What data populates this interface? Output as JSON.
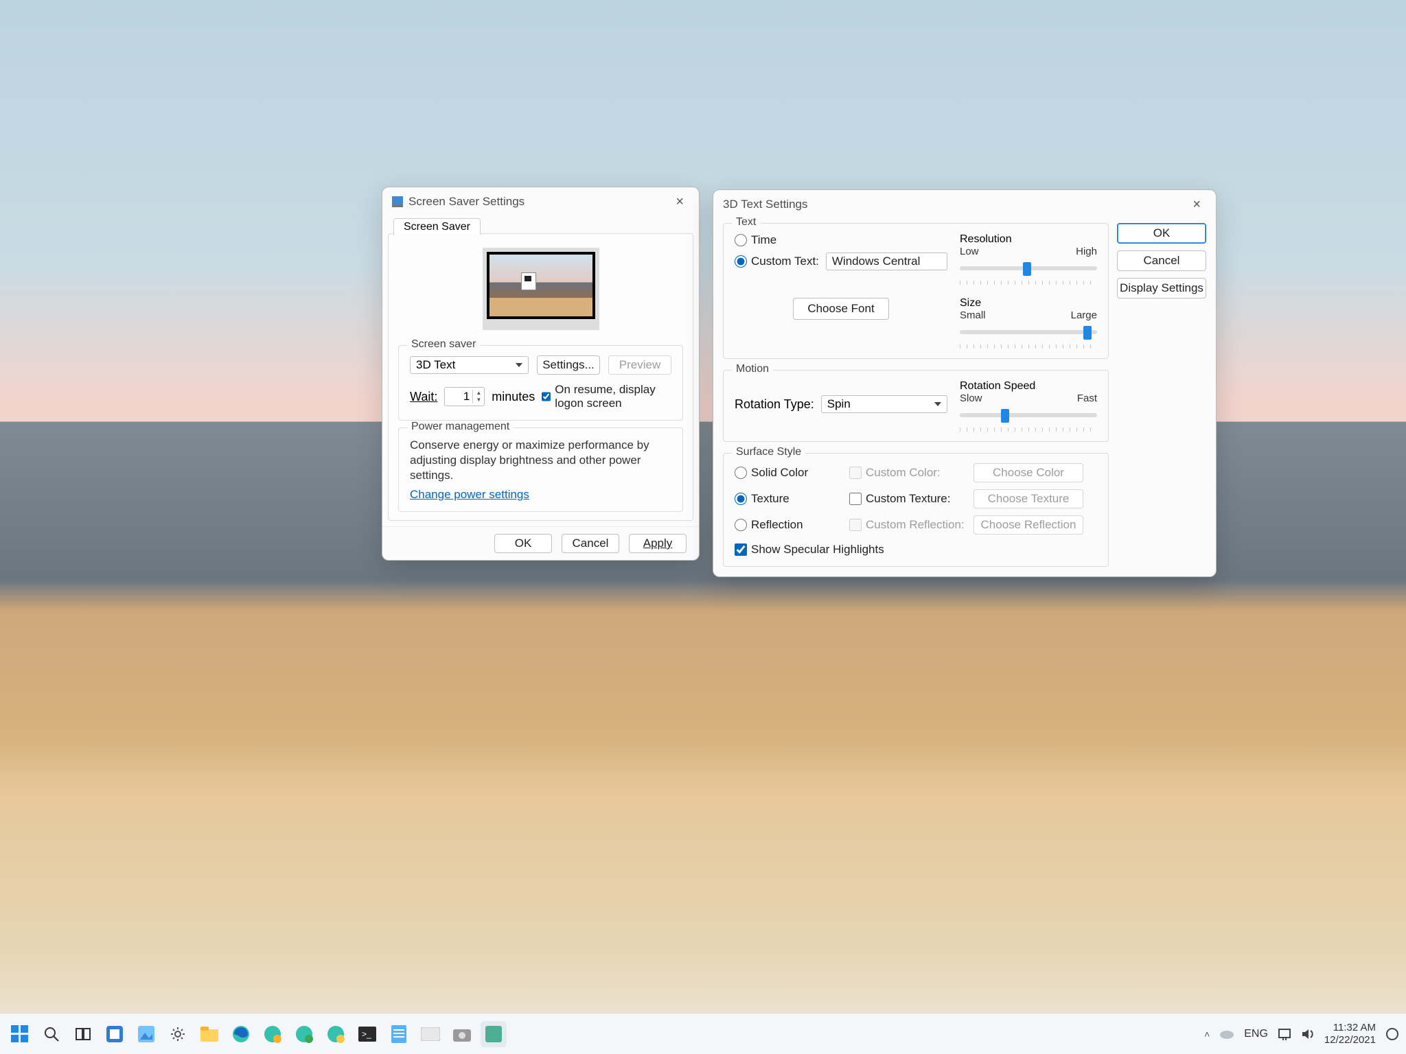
{
  "screensaver": {
    "title": "Screen Saver Settings",
    "tab": "Screen Saver",
    "section_label": "Screen saver",
    "selected": "3D Text",
    "settings_btn": "Settings...",
    "preview_btn": "Preview",
    "wait_label": "Wait:",
    "wait_value": "1",
    "wait_unit": "minutes",
    "resume_label": "On resume, display logon screen",
    "pm_label": "Power management",
    "pm_text": "Conserve energy or maximize performance by adjusting display brightness and other power settings.",
    "pm_link": "Change power settings",
    "ok": "OK",
    "cancel": "Cancel",
    "apply": "Apply"
  },
  "text3d": {
    "title": "3D Text Settings",
    "ok": "OK",
    "cancel": "Cancel",
    "display_settings": "Display Settings",
    "group_text": "Text",
    "opt_time": "Time",
    "opt_custom": "Custom Text:",
    "custom_value": "Windows Central",
    "choose_font": "Choose Font",
    "resolution": "Resolution",
    "res_low": "Low",
    "res_high": "High",
    "size": "Size",
    "size_small": "Small",
    "size_large": "Large",
    "group_motion": "Motion",
    "rotation_type": "Rotation Type:",
    "rotation_value": "Spin",
    "rotation_speed": "Rotation Speed",
    "speed_slow": "Slow",
    "speed_fast": "Fast",
    "group_surface": "Surface Style",
    "opt_solid": "Solid Color",
    "opt_texture": "Texture",
    "opt_reflection": "Reflection",
    "chk_customcolor": "Custom Color:",
    "chk_customtex": "Custom Texture:",
    "chk_customrefl": "Custom Reflection:",
    "btn_color": "Choose Color",
    "btn_tex": "Choose Texture",
    "btn_refl": "Choose Reflection",
    "specular": "Show Specular Highlights"
  },
  "taskbar": {
    "lang": "ENG",
    "time": "11:32 AM",
    "date": "12/22/2021"
  }
}
